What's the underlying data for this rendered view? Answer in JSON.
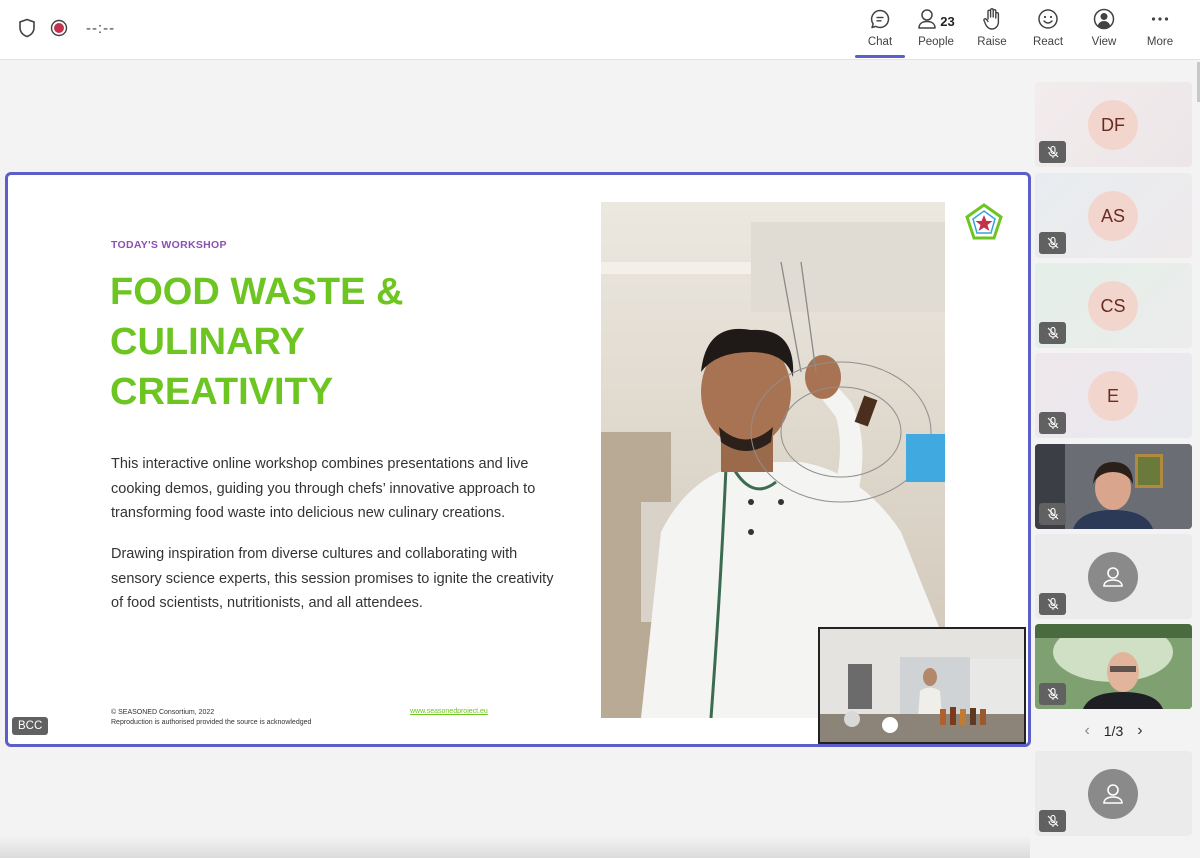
{
  "topbar": {
    "timer": "--:--",
    "chat_label": "Chat",
    "people_label": "People",
    "people_count": "23",
    "raise_label": "Raise",
    "react_label": "React",
    "view_label": "View",
    "more_label": "More"
  },
  "slide": {
    "kicker": "TODAY'S WORKSHOP",
    "title_line1": "FOOD WASTE &",
    "title_line2": "CULINARY",
    "title_line3": "CREATIVITY",
    "para1": "This interactive online workshop combines presentations and live cooking demos, guiding you through chefs’ innovative approach to transforming food waste into delicious new culinary creations.",
    "para2": "Drawing inspiration from diverse cultures and collaborating with sensory science experts, this session promises to ignite the creativity of food scientists, nutritionists, and all attendees.",
    "footer_line1": "© SEASONED Consortium, 2022",
    "footer_line2": "Reproduction is authorised provided the source is acknowledged",
    "footer_link": "www.seasonedproject.eu"
  },
  "stage": {
    "presenter_badge": "BCC"
  },
  "participants": [
    {
      "initials": "DF"
    },
    {
      "initials": "AS"
    },
    {
      "initials": "CS"
    },
    {
      "initials": "E"
    }
  ],
  "pager": {
    "text": "1/3"
  },
  "colors": {
    "accent": "#5b5fc7",
    "title_green": "#6dc521",
    "kicker_purple": "#8b4fb6"
  }
}
